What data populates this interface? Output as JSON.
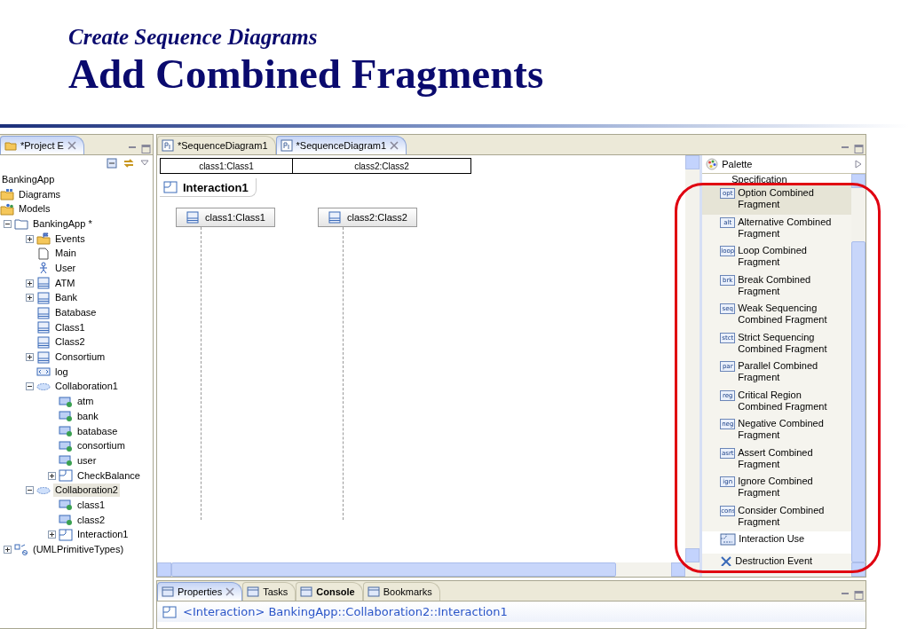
{
  "slide": {
    "subtitle": "Create Sequence Diagrams",
    "title": "Add Combined Fragments"
  },
  "explorer": {
    "tab": {
      "label": "*Project E",
      "selected": true
    },
    "tree": [
      {
        "label": "BankingApp",
        "kind": "root",
        "selected": false
      },
      {
        "label": "Diagrams",
        "kind": "diagrams",
        "selected": false
      },
      {
        "label": "Models",
        "kind": "models",
        "selected": false
      },
      {
        "label": "BankingApp *",
        "kind": "package",
        "expanded": true,
        "selected": false,
        "children": [
          {
            "label": "Events",
            "kind": "events",
            "expanded": false,
            "selected": false
          },
          {
            "label": "Main",
            "kind": "file",
            "selected": false
          },
          {
            "label": "User",
            "kind": "actor",
            "selected": false
          },
          {
            "label": "ATM",
            "kind": "class",
            "expanded": false,
            "selected": false
          },
          {
            "label": "Bank",
            "kind": "class",
            "expanded": false,
            "selected": false
          },
          {
            "label": "Batabase",
            "kind": "class",
            "selected": false
          },
          {
            "label": "Class1",
            "kind": "class",
            "selected": false
          },
          {
            "label": "Class2",
            "kind": "class",
            "selected": false
          },
          {
            "label": "Consortium",
            "kind": "class",
            "expanded": false,
            "selected": false
          },
          {
            "label": "log",
            "kind": "stereotype",
            "selected": false
          },
          {
            "label": "Collaboration1",
            "kind": "collaboration",
            "expanded": true,
            "selected": false,
            "children": [
              {
                "label": "atm",
                "kind": "part",
                "selected": false
              },
              {
                "label": "bank",
                "kind": "part",
                "selected": false
              },
              {
                "label": "batabase",
                "kind": "part",
                "selected": false
              },
              {
                "label": "consortium",
                "kind": "part",
                "selected": false
              },
              {
                "label": "user",
                "kind": "part",
                "selected": false
              },
              {
                "label": "CheckBalance",
                "kind": "interaction",
                "expanded": false,
                "selected": false
              }
            ]
          },
          {
            "label": "Collaboration2",
            "kind": "collaboration",
            "expanded": true,
            "selected": true,
            "children": [
              {
                "label": "class1",
                "kind": "part",
                "selected": false
              },
              {
                "label": "class2",
                "kind": "part",
                "selected": false
              },
              {
                "label": "Interaction1",
                "kind": "interaction",
                "expanded": false,
                "selected": false
              }
            ]
          }
        ]
      },
      {
        "label": "(UMLPrimitiveTypes)",
        "kind": "primitives",
        "expanded": false,
        "selected": false
      }
    ]
  },
  "editor": {
    "tabs": [
      {
        "label": "*SequenceDiagram1",
        "selected": false
      },
      {
        "label": "*SequenceDiagram1",
        "selected": true
      }
    ],
    "ruler": [
      "class1:Class1",
      "class2:Class2"
    ],
    "interaction": "Interaction1",
    "lifelines": [
      "class1:Class1",
      "class2:Class2"
    ]
  },
  "palette": {
    "title": "Palette",
    "items": [
      {
        "kind": "partial",
        "label": "Specification",
        "selected": false
      },
      {
        "kind": "tool",
        "icon_label": "opt",
        "label": "Option Combined Fragment",
        "selected": true
      },
      {
        "kind": "tool",
        "icon_label": "alt",
        "label": "Alternative Combined Fragment",
        "selected": false
      },
      {
        "kind": "tool",
        "icon_label": "loop",
        "label": "Loop Combined Fragment",
        "selected": false
      },
      {
        "kind": "tool",
        "icon_label": "brk",
        "label": "Break Combined Fragment",
        "selected": false
      },
      {
        "kind": "tool",
        "icon_label": "seq",
        "label": "Weak Sequencing Combined Fragment",
        "selected": false
      },
      {
        "kind": "tool",
        "icon_label": "stct",
        "label": "Strict Sequencing Combined Fragment",
        "selected": false
      },
      {
        "kind": "tool",
        "icon_label": "par",
        "label": "Parallel Combined Fragment",
        "selected": false
      },
      {
        "kind": "tool",
        "icon_label": "reg",
        "label": "Critical Region Combined Fragment",
        "selected": false
      },
      {
        "kind": "tool",
        "icon_label": "neg",
        "label": "Negative Combined Fragment",
        "selected": false
      },
      {
        "kind": "tool",
        "icon_label": "asrt",
        "label": "Assert Combined Fragment",
        "selected": false
      },
      {
        "kind": "tool",
        "icon_label": "ign",
        "label": "Ignore Combined Fragment",
        "selected": false
      },
      {
        "kind": "tool",
        "icon_label": "cons",
        "label": "Consider Combined Fragment",
        "selected": false
      },
      {
        "kind": "use",
        "label": "Interaction Use",
        "selected": false
      },
      {
        "kind": "destroy",
        "label": "Destruction Event",
        "selected": false
      }
    ]
  },
  "bottom": {
    "tabs": [
      {
        "label": "Properties",
        "selected": true,
        "bold": false
      },
      {
        "label": "Tasks",
        "selected": false,
        "bold": false
      },
      {
        "label": "Console",
        "selected": false,
        "bold": true
      },
      {
        "label": "Bookmarks",
        "selected": false,
        "bold": false
      }
    ],
    "heading": "<Interaction> BankingApp::Collaboration2::Interaction1"
  }
}
